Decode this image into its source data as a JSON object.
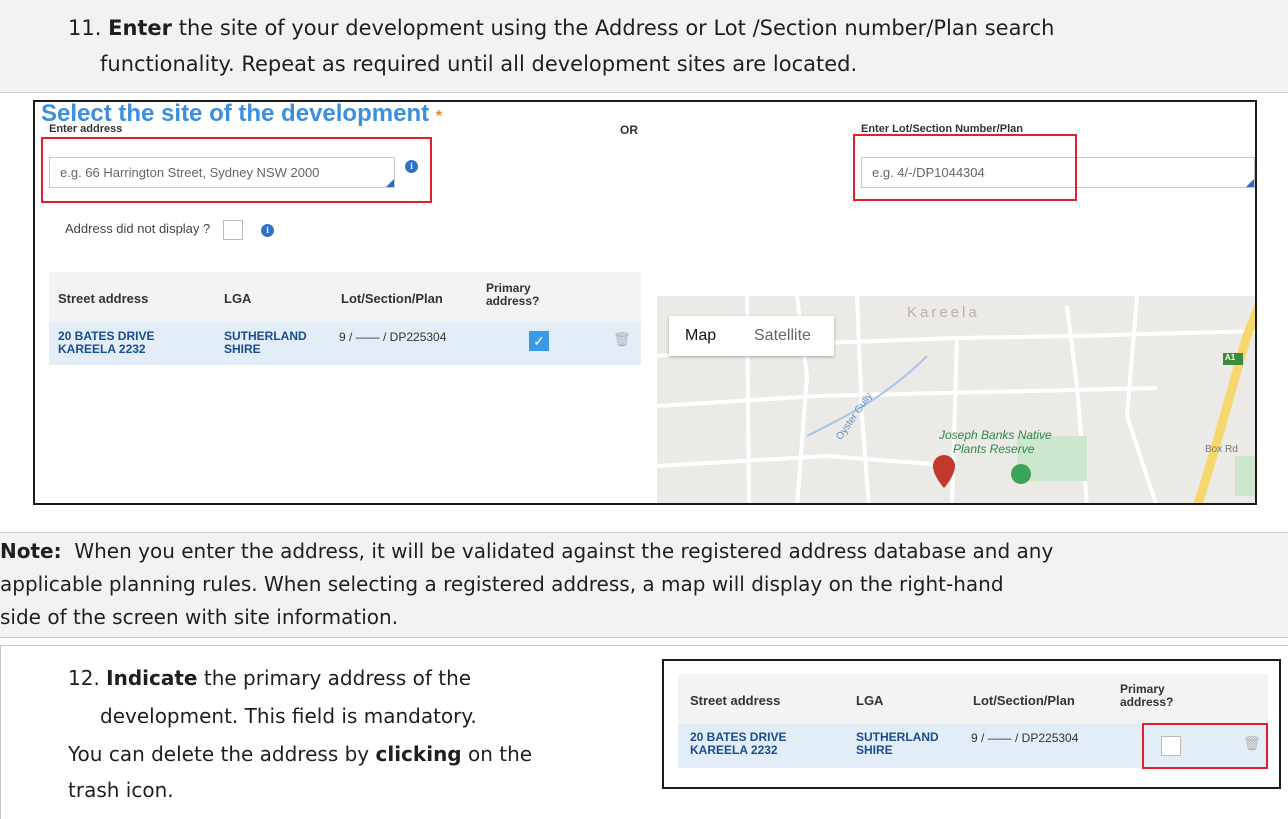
{
  "step11": {
    "number": "11.",
    "verb": "Enter",
    "text_line1": "the site of your development using the Address or Lot /Section number/Plan search",
    "text_line2": "functionality. Repeat as required until all development sites are located."
  },
  "form": {
    "title": "Select the site of the development",
    "required_mark": "*",
    "address_label": "Enter address",
    "address_placeholder": "e.g. 66 Harrington Street, Sydney NSW 2000",
    "or_label": "OR",
    "lot_label": "Enter Lot/Section Number/Plan",
    "lot_placeholder": "e.g. 4/-/DP1044304",
    "address_not_display": "Address did not display ?",
    "info_glyph": "i"
  },
  "table": {
    "headers": [
      "Street address",
      "LGA",
      "Lot/Section/Plan",
      "Primary address?"
    ],
    "row": {
      "street_line1": "20 BATES DRIVE",
      "street_line2": "KAREELA 2232",
      "lga_line1": "SUTHERLAND",
      "lga_line2": "SHIRE",
      "lot": "9 / —— / DP225304"
    }
  },
  "map": {
    "tab_map": "Map",
    "tab_satellite": "Satellite",
    "place_label": "Kareela",
    "park_label_1": "Joseph Banks Native",
    "park_label_2": "Plants Reserve",
    "road_label_1": "Box Rd",
    "road_label_2": "Oyster Gully",
    "badge": "A1"
  },
  "note": {
    "label": "Note:",
    "line1": "When you enter the address, it will be validated against the registered address database and any",
    "line2": "applicable planning rules. When selecting a registered address, a map will display on the right-hand",
    "line3": "side of the screen with site information."
  },
  "step12": {
    "number": "12.",
    "verb": "Indicate",
    "text_line1": "the primary address of the",
    "text_line2": "development. This field is mandatory.",
    "line3_pre": "You can delete the address by",
    "line3_bold": "clicking",
    "line3_post": "on the",
    "line4": "trash icon."
  },
  "colors": {
    "title_blue": "#3b8fde",
    "highlight_red": "#e0202a",
    "row_blue": "#e3edf8"
  }
}
